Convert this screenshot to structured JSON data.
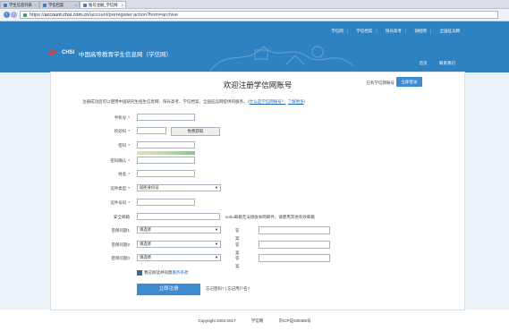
{
  "browser": {
    "tabs": [
      {
        "label": "学生信息列表"
      },
      {
        "label": "学信档案"
      },
      {
        "label": "账号注册_学信网",
        "active": true
      }
    ],
    "url_scheme": "https://",
    "url_host": "account.chsi.com.cn",
    "url_path": "/account/preregister.action?from=archive"
  },
  "header": {
    "top_nav": [
      "学信网",
      "学信档案",
      "阳光高考",
      "研招网",
      "全国征兵网"
    ],
    "logo_brand": "CHSI",
    "logo_name": "中国高等教育学生信息网（学信网）",
    "right_links": [
      "首页",
      "联系我们"
    ]
  },
  "card": {
    "title": "欢迎注册学信网账号",
    "already_label": "已有学信网账号",
    "login_button": "立即登录",
    "intro_text": "注册成功后可以使用中国研究生招生信息网、阳光高考、学信档案、全国征兵网提供的服务。（",
    "intro_link1": "什么是学信网账号？",
    "intro_link2": "了解更多",
    "intro_close": "）"
  },
  "form": {
    "required_mark": "*",
    "mobile_label": "手机号",
    "captcha_label": "校验码",
    "captcha_button": "免费获取",
    "password_label": "密码",
    "password_confirm_label": "密码确认",
    "name_label": "姓名",
    "id_type_label": "证件类型",
    "id_type_value": "居民身份证",
    "id_number_label": "证件号码",
    "email_label": "安全邮箱",
    "email_hint": "sohu邮箱无法接收本网邮件，请使用其他有效邮箱",
    "q1_label": "密保问题1",
    "q2_label": "密保问题2",
    "q3_label": "密保问题3",
    "q_placeholder": "请选择",
    "answer_label": "答案",
    "agree_text": "我已阅读并同意",
    "agree_link": "服务条款",
    "submit_button": "立即注册",
    "forgot_password": "忘记密码?",
    "forgot_sep": " | ",
    "forgot_username": "忘记用户名?"
  },
  "footer": {
    "copyright": "Copyright 2003-2017",
    "site": "学信网",
    "icp": "京ICP证030485号"
  },
  "colors": {
    "header_blue": "#2f82c2",
    "button_blue": "#3d8bd0",
    "link_blue": "#1d66b4",
    "required_red": "#dd0000"
  }
}
